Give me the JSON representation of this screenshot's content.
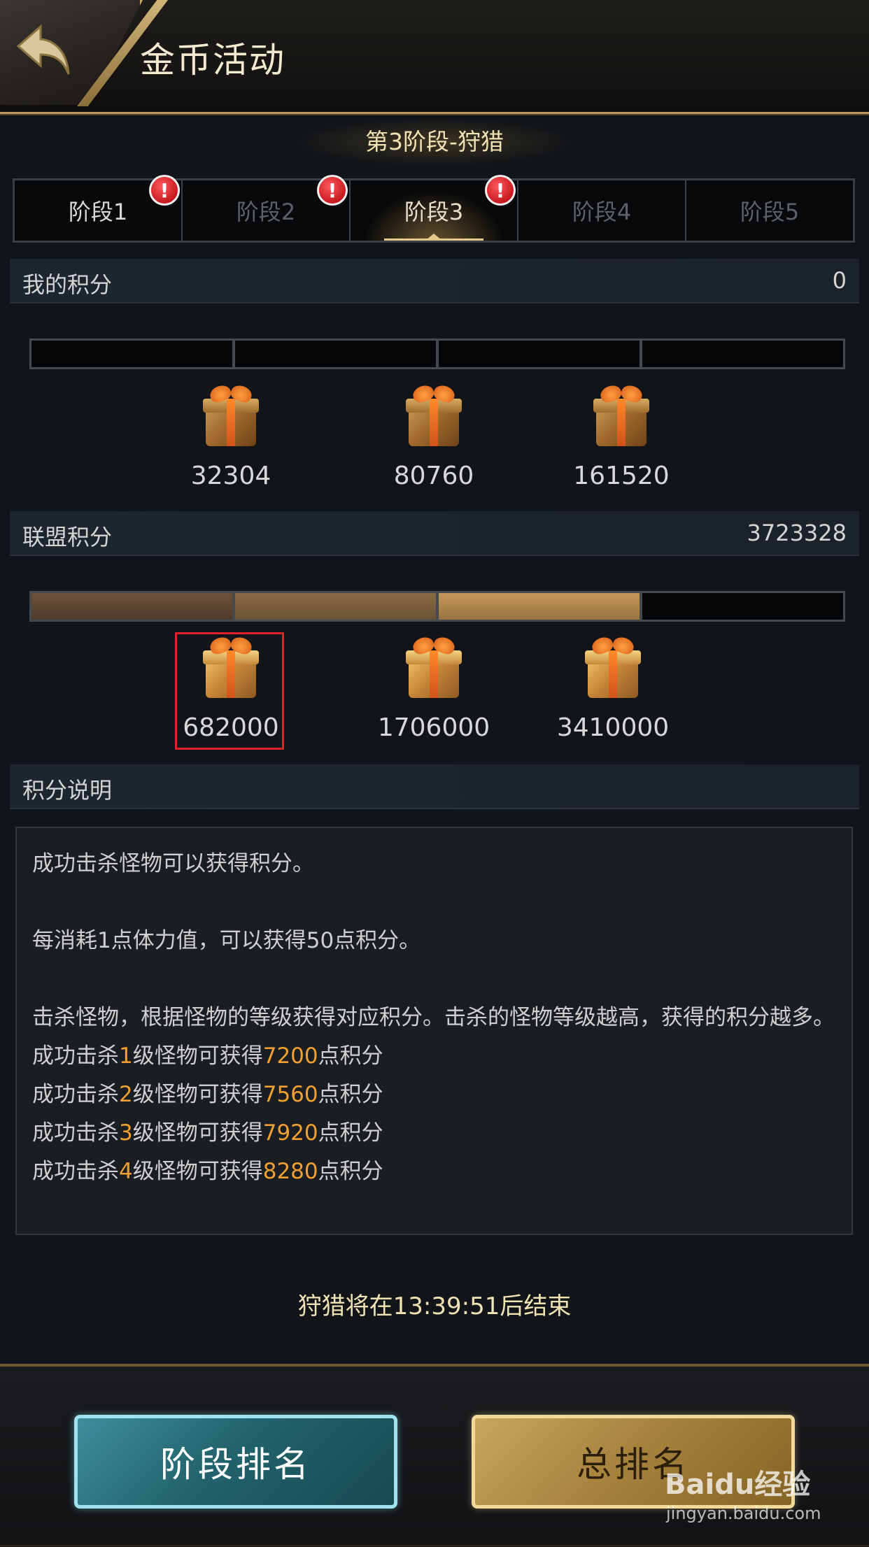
{
  "header": {
    "title": "金币活动"
  },
  "stage": {
    "title": "第3阶段-狩猎",
    "tabs": [
      {
        "label": "阶段1",
        "badge": "!"
      },
      {
        "label": "阶段2",
        "badge": "!"
      },
      {
        "label": "阶段3",
        "badge": "!"
      },
      {
        "label": "阶段4"
      },
      {
        "label": "阶段5"
      }
    ]
  },
  "my_score": {
    "label": "我的积分",
    "value": "0",
    "progress_fraction": 0,
    "rewards": [
      {
        "points": "32304"
      },
      {
        "points": "80760"
      },
      {
        "points": "161520"
      }
    ]
  },
  "alliance_score": {
    "label": "联盟积分",
    "value": "3723328",
    "progress_fraction": 0.75,
    "rewards": [
      {
        "points": "682000"
      },
      {
        "points": "1706000"
      },
      {
        "points": "3410000"
      }
    ]
  },
  "explanation": {
    "label": "积分说明",
    "lines": [
      "成功击杀怪物可以获得积分。",
      "每消耗1点体力值，可以获得50点积分。",
      "击杀怪物，根据怪物的等级获得对应积分。击杀的怪物等级越高，获得的积分越多。"
    ],
    "levels": [
      {
        "prefix": "成功击杀",
        "level": "1",
        "mid": "级怪物可获得",
        "points": "7200",
        "suffix": "点积分"
      },
      {
        "prefix": "成功击杀",
        "level": "2",
        "mid": "级怪物可获得",
        "points": "7560",
        "suffix": "点积分"
      },
      {
        "prefix": "成功击杀",
        "level": "3",
        "mid": "级怪物可获得",
        "points": "7920",
        "suffix": "点积分"
      },
      {
        "prefix": "成功击杀",
        "level": "4",
        "mid": "级怪物可获得",
        "points": "8280",
        "suffix": "点积分"
      }
    ]
  },
  "countdown": "狩猎将在13:39:51后结束",
  "buttons": {
    "stage_rank": "阶段排名",
    "total_rank": "总排名"
  },
  "watermark": {
    "text": "Baidu经验",
    "url": "jingyan.baidu.com"
  },
  "colors": {
    "accent_gold": "#f1e2b4",
    "highlight_orange": "#f0a030",
    "alert_red": "#d0191f",
    "teal_button": "#23636d"
  }
}
